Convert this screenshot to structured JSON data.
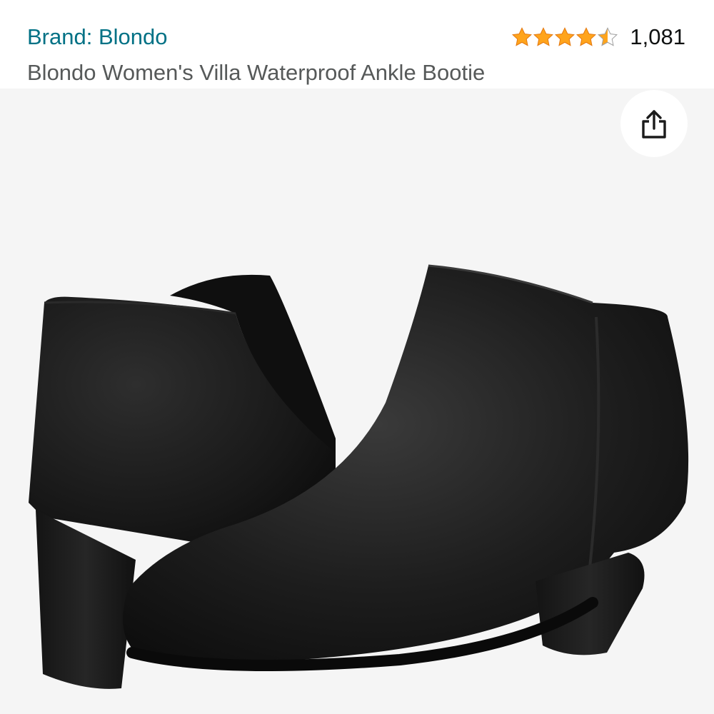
{
  "header": {
    "brand_link": "Brand: Blondo",
    "product_title": "Blondo Women's Villa Waterproof Ankle Bootie",
    "rating": {
      "stars": 4.5,
      "out_of": 5,
      "count": "1,081"
    }
  },
  "colors": {
    "link": "#007185",
    "title": "#565959",
    "star_fill": "#FFA41C",
    "image_background": "#F5F5F5"
  },
  "icons": {
    "share": "share-icon",
    "star": "star-icon"
  }
}
